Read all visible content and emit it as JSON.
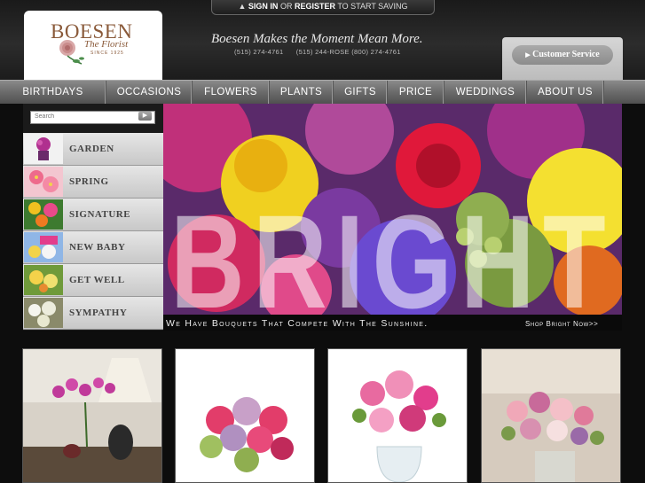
{
  "header": {
    "sign_in": "SIGN IN",
    "or": "OR",
    "register": "REGISTER",
    "start_saving": "TO START SAVING",
    "logo_name": "BOESEN",
    "logo_sub": "The Florist",
    "logo_since": "SINCE 1925",
    "tagline": "Boesen Makes the Moment Mean More.",
    "phones": "(515) 274-4761      (515) 244-ROSE (800) 274-4761",
    "customer_service": "Customer Service"
  },
  "nav": {
    "items": [
      "BIRTHDAYS",
      "OCCASIONS",
      "FLOWERS",
      "PLANTS",
      "GIFTS",
      "PRICE",
      "WEDDINGS",
      "ABOUT US"
    ]
  },
  "sidebar": {
    "search_placeholder": "Search",
    "categories": [
      "GARDEN",
      "SPRING",
      "SIGNATURE",
      "NEW BABY",
      "GET WELL",
      "SYMPATHY"
    ]
  },
  "hero": {
    "headline": "BRIGHT",
    "caption": "We Have Bouquets That Compete With The Sunshine.",
    "link": "Shop Bright Now>>"
  },
  "colors": {
    "background": "#0d0d0d",
    "nav": "#6e6e6e",
    "logo_brown": "#8a5a3a",
    "accent_pink": "#e23d8c"
  }
}
